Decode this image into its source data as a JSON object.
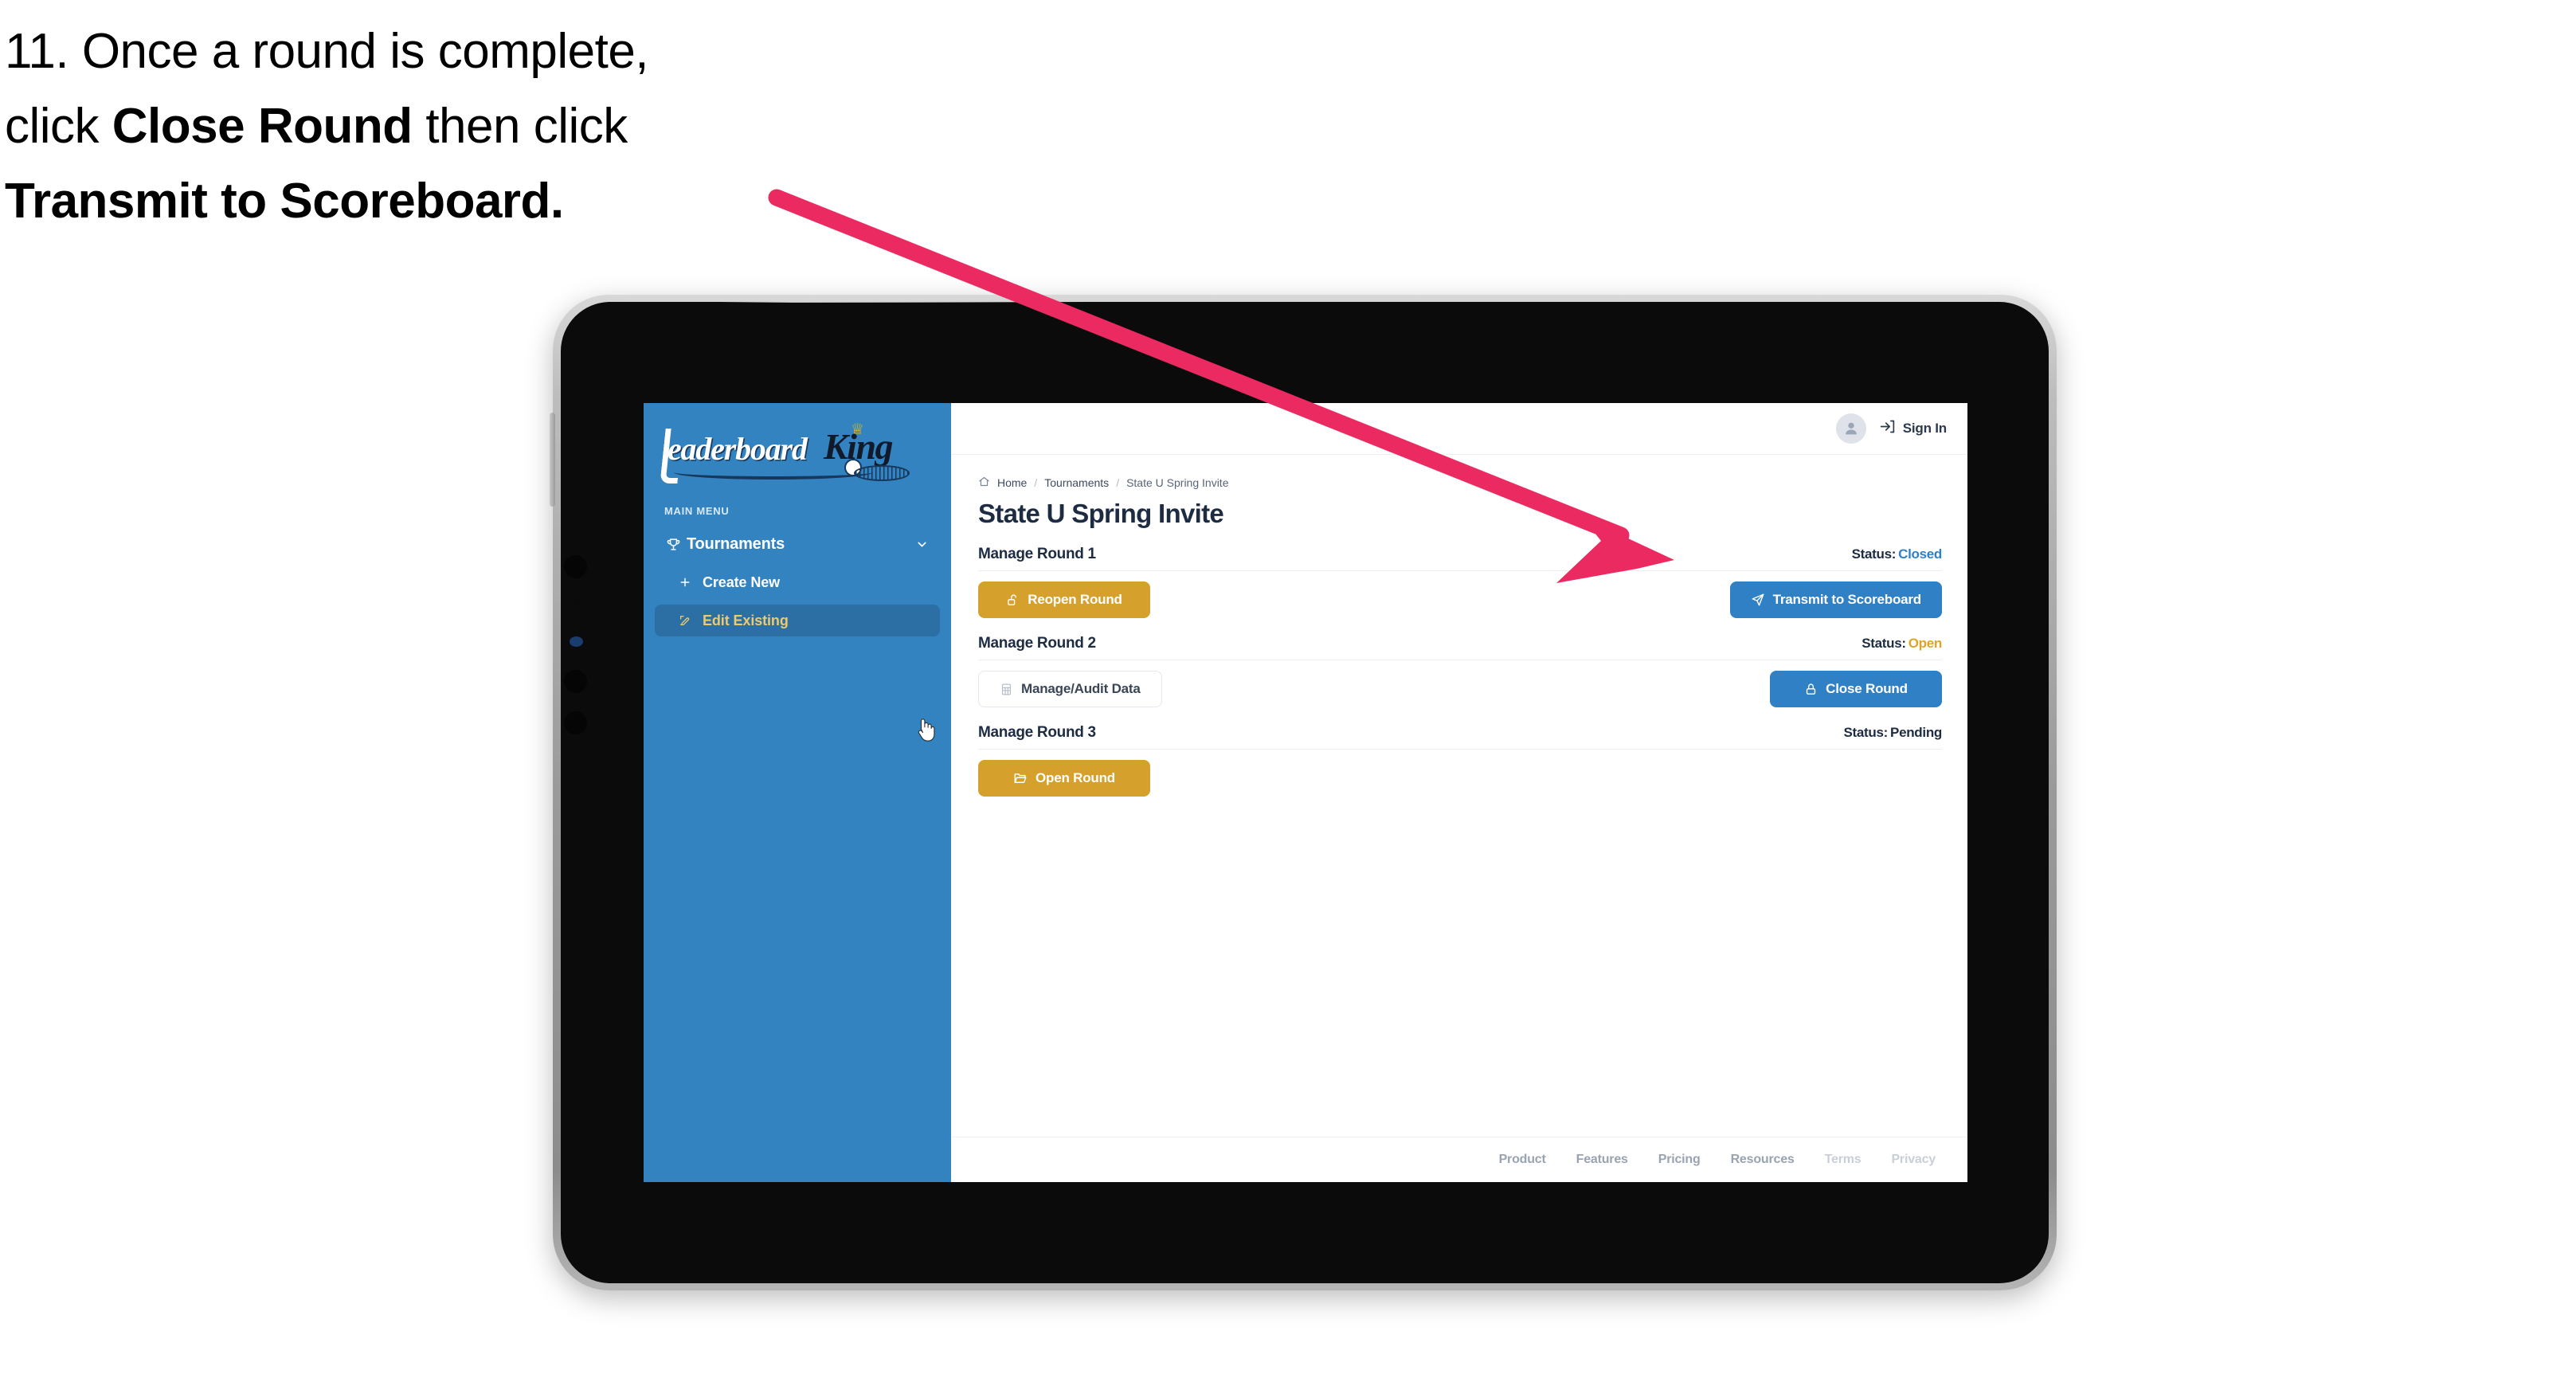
{
  "caption": {
    "step_number": "11.",
    "line1_pre": "11. Once a round is complete,",
    "line2_pre": "click ",
    "line2_bold": "Close Round",
    "line2_post": " then click",
    "line3_bold": "Transmit to Scoreboard."
  },
  "colors": {
    "sidebar_blue": "#3283c0",
    "sidebar_active_blue": "#2b6fa4",
    "accent_gold": "#d6a02c",
    "accent_blue": "#2f80c4",
    "status_open_gold": "#e0a424",
    "status_closed_blue": "#2f80c4",
    "annotation_pink": "#ec2a62",
    "edit_existing_gold_text": "#edc96f"
  },
  "sidebar": {
    "logo": {
      "word": "eaderboard",
      "king": "King",
      "icon": "golf-club-logo-icon"
    },
    "section_label": "MAIN MENU",
    "nav_group": {
      "label": "Tournaments",
      "icon": "trophy-icon",
      "chevron": "chevron-down-icon",
      "expanded": true
    },
    "nav_items": [
      {
        "label": "Create New",
        "icon": "plus-icon",
        "active": false
      },
      {
        "label": "Edit Existing",
        "icon": "pencil-square-icon",
        "active": true
      }
    ],
    "cursor": "pointing-hand-cursor"
  },
  "topbar": {
    "avatar_icon": "user-avatar-icon",
    "signin_icon": "sign-in-arrow-icon",
    "signin_label": "Sign In"
  },
  "breadcrumb": {
    "home_icon": "home-icon",
    "items": [
      "Home",
      "Tournaments",
      "State U Spring Invite"
    ],
    "separator": "/"
  },
  "page": {
    "title": "State U Spring Invite"
  },
  "rounds": [
    {
      "title": "Manage Round 1",
      "status_label": "Status:",
      "status_value": "Closed",
      "status_class": "status-closed",
      "left_button": {
        "label": "Reopen Round",
        "icon": "unlock-icon",
        "style": "gold"
      },
      "right_button": {
        "label": "Transmit to Scoreboard",
        "icon": "paper-plane-icon",
        "style": "blue"
      }
    },
    {
      "title": "Manage Round 2",
      "status_label": "Status:",
      "status_value": "Open",
      "status_class": "status-open",
      "left_button": {
        "label": "Manage/Audit Data",
        "icon": "table-grid-icon",
        "style": "ghost"
      },
      "right_button": {
        "label": "Close Round",
        "icon": "lock-icon",
        "style": "blue"
      }
    },
    {
      "title": "Manage Round 3",
      "status_label": "Status:",
      "status_value": "Pending",
      "status_class": "status-pending",
      "left_button": {
        "label": "Open Round",
        "icon": "folder-open-icon",
        "style": "gold"
      },
      "right_button": null
    }
  ],
  "footer": {
    "links": [
      {
        "label": "Product",
        "muted": false
      },
      {
        "label": "Features",
        "muted": false
      },
      {
        "label": "Pricing",
        "muted": false
      },
      {
        "label": "Resources",
        "muted": false
      },
      {
        "label": "Terms",
        "muted": true
      },
      {
        "label": "Privacy",
        "muted": true
      }
    ]
  },
  "annotation": {
    "arrow_name": "instruction-arrow",
    "points_to": "Transmit to Scoreboard"
  }
}
